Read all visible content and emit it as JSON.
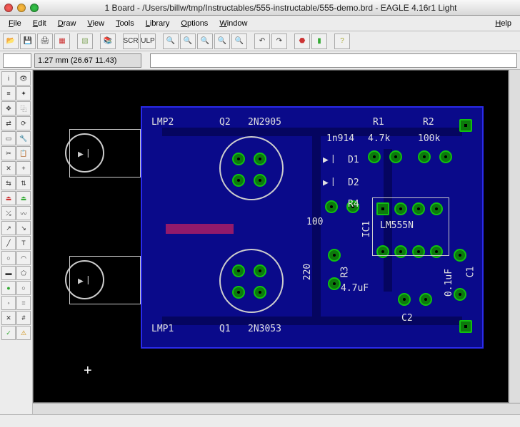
{
  "window": {
    "title": "1 Board - /Users/billw/tmp/Instructables/555-instructable/555-demo.brd - EAGLE 4.16r1 Light"
  },
  "menu": {
    "file": "File",
    "edit": "Edit",
    "draw": "Draw",
    "view": "View",
    "tools": "Tools",
    "library": "Library",
    "options": "Options",
    "window": "Window",
    "help": "Help"
  },
  "status": {
    "coord": "1.27 mm (26.67 11.43)"
  },
  "labels": {
    "lmp1": "LMP1",
    "lmp2": "LMP2",
    "q1": "Q1",
    "q1v": "2N3053",
    "q2": "Q2",
    "q2v": "2N2905",
    "d1": "D1",
    "d2": "D2",
    "dval": "1n914",
    "r1": "R1",
    "r1v": "4.7k",
    "r2": "R2",
    "r2v": "100k",
    "r3": "R3",
    "r3v": "4.7uF",
    "r4": "R4",
    "r4v": "100",
    "c1": "C1",
    "c1v": "0.1uF",
    "c2": "C2",
    "lm": "LM555N",
    "ic1": "IC1",
    "v220": "220"
  },
  "colors": {
    "copper": "#0a0a8a",
    "pad": "#0c7a0c",
    "silk": "#e0e0e0"
  }
}
